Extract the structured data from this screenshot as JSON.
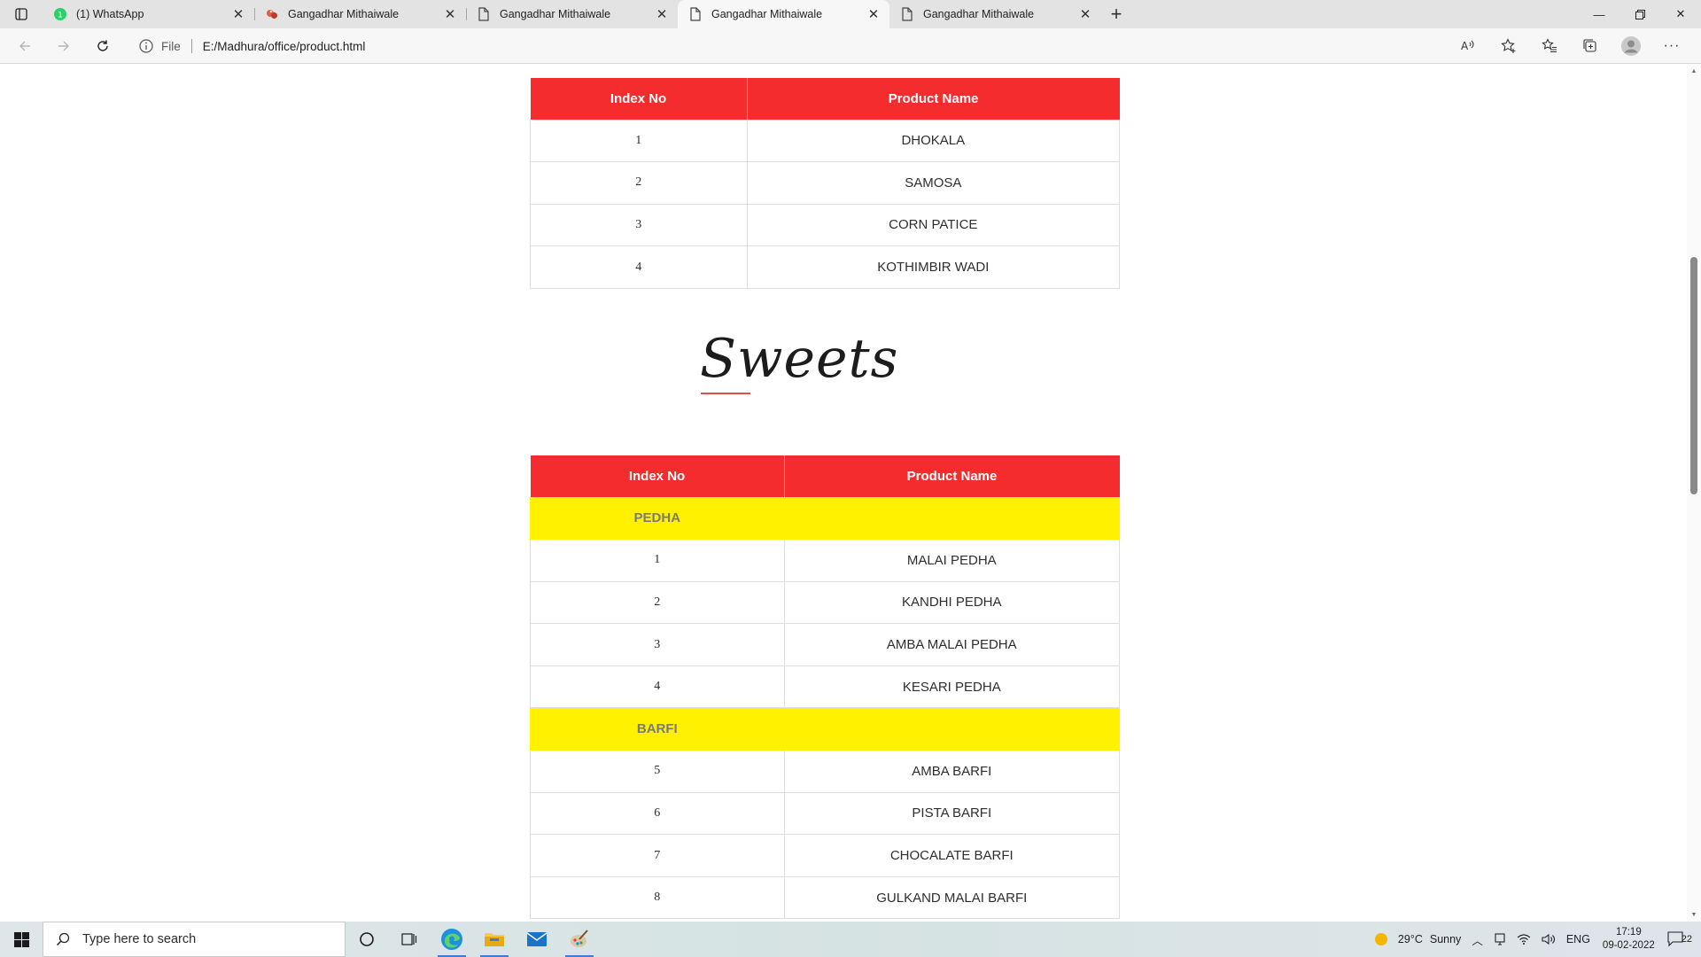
{
  "browser": {
    "tabs": [
      {
        "title": "(1) WhatsApp",
        "favicon": "whatsapp-icon",
        "badge": "1",
        "active": false
      },
      {
        "title": "Gangadhar Mithaiwale",
        "favicon": "sweets-logo-icon",
        "active": false
      },
      {
        "title": "Gangadhar Mithaiwale",
        "favicon": "page-icon",
        "active": false
      },
      {
        "title": "Gangadhar Mithaiwale",
        "favicon": "page-icon",
        "active": true
      },
      {
        "title": "Gangadhar Mithaiwale",
        "favicon": "page-icon",
        "active": false
      }
    ],
    "address": {
      "scheme": "File",
      "url": "E:/Madhura/office/product.html"
    }
  },
  "page": {
    "table1": {
      "headers": [
        "Index No",
        "Product Name"
      ],
      "rows": [
        {
          "index": "1",
          "name": "DHOKALA"
        },
        {
          "index": "2",
          "name": "SAMOSA"
        },
        {
          "index": "3",
          "name": "CORN PATICE"
        },
        {
          "index": "4",
          "name": "KOTHIMBIR WADI"
        }
      ]
    },
    "heading": "Sweets",
    "table2": {
      "headers": [
        "Index No",
        "Product Name"
      ],
      "rows": [
        {
          "category": "PEDHA"
        },
        {
          "index": "1",
          "name": "MALAI PEDHA"
        },
        {
          "index": "2",
          "name": "KANDHI PEDHA"
        },
        {
          "index": "3",
          "name": "AMBA MALAI PEDHA"
        },
        {
          "index": "4",
          "name": "KESARI PEDHA"
        },
        {
          "category": "BARFI"
        },
        {
          "index": "5",
          "name": "AMBA BARFI"
        },
        {
          "index": "6",
          "name": "PISTA BARFI"
        },
        {
          "index": "7",
          "name": "CHOCALATE BARFI"
        },
        {
          "index": "8",
          "name": "GULKAND MALAI BARFI"
        }
      ]
    },
    "colors": {
      "header": "#f42c2e",
      "category_row": "#fff100"
    }
  },
  "taskbar": {
    "search_placeholder": "Type here to search",
    "weather": {
      "temp": "29°C",
      "condition": "Sunny"
    },
    "language": "ENG",
    "time": "17:19",
    "date": "09-02-2022",
    "notifications": "22"
  }
}
